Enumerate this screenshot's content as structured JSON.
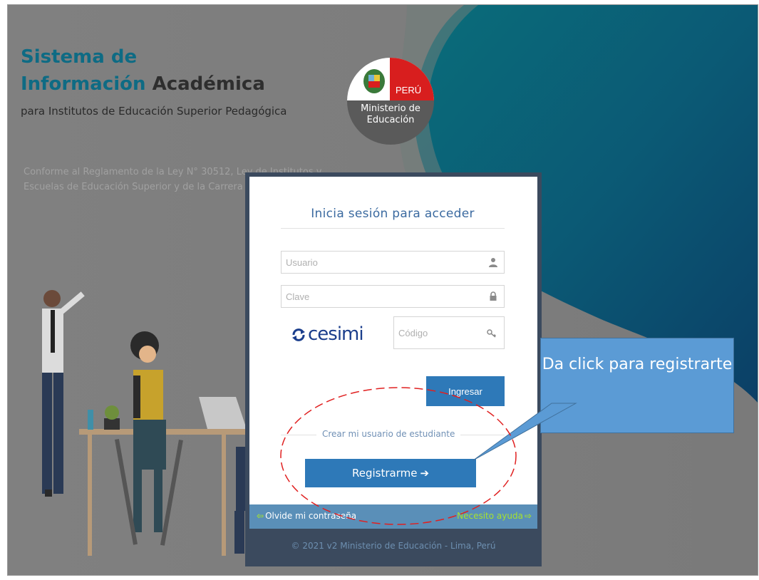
{
  "header": {
    "title_line1": "Sistema de",
    "title_line2_accent": "Información",
    "title_line2_dark": "Académica",
    "subtitle": "para Institutos de Educación Superior Pedagógica",
    "legal": "Conforme al Reglamento de la Ley N° 30512, Ley de Institutos y Escuelas de Educación Superior y de la Carrera"
  },
  "seal": {
    "country": "PERÚ",
    "ministry": "Ministerio de Educación"
  },
  "login": {
    "title": "Inicia sesión para acceder",
    "user_placeholder": "Usuario",
    "password_placeholder": "Clave",
    "captcha_text": "cesimi",
    "code_placeholder": "Código",
    "login_button": "Ingresar",
    "register_caption": "Crear mi usuario de estudiante",
    "register_button": "Registrarme",
    "forgot_link": "Olvide mi contraseña",
    "help_link": "Necesito ayuda",
    "copyright": "© 2021 v2 Ministerio de Educación - Lima, Perú"
  },
  "annotation": {
    "callout_text": "Da click para registrarte"
  },
  "colors": {
    "accent": "#0e6b84",
    "button": "#2e79b8",
    "callout": "#5b9bd5",
    "annotation_red": "#e02020"
  }
}
